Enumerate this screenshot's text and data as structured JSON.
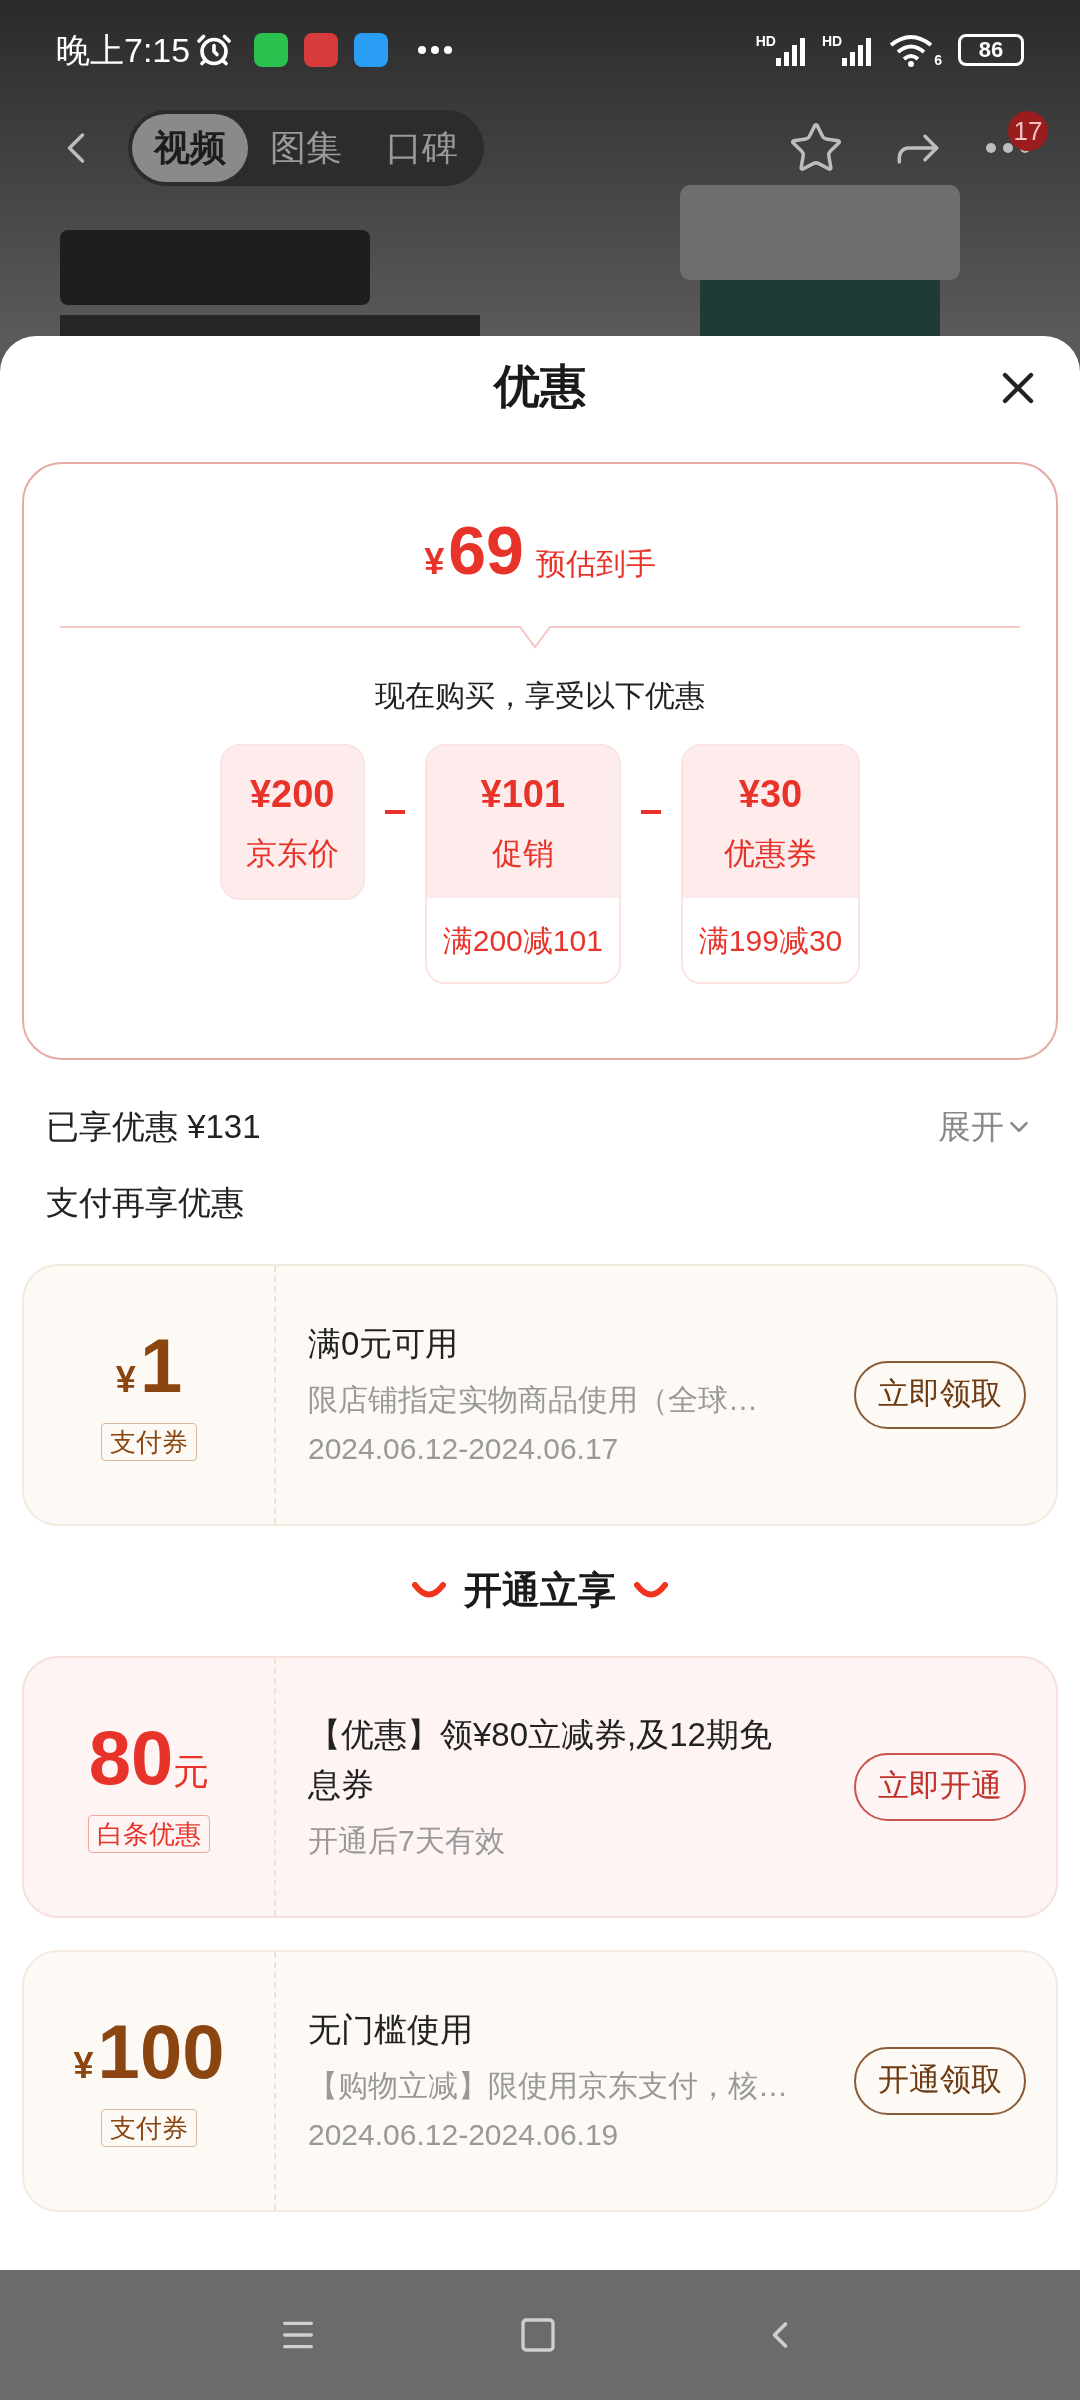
{
  "status_bar": {
    "time": "晚上7:15",
    "signals": [
      {
        "label": "HD"
      },
      {
        "label": "HD"
      }
    ],
    "wifi_label": "6",
    "battery": "86"
  },
  "header": {
    "tabs": [
      {
        "label": "视频",
        "selected": true
      },
      {
        "label": "图集",
        "selected": false
      },
      {
        "label": "口碑",
        "selected": false
      }
    ],
    "badge": "17"
  },
  "sheet": {
    "title": "优惠",
    "estimate": {
      "currency": "¥",
      "price": "69",
      "label": "预估到手"
    },
    "intro": "现在购买，享受以下优惠",
    "breakdown": [
      {
        "amount": "¥200",
        "label": "京东价"
      },
      {
        "amount": "¥101",
        "label": "促销",
        "condition": "满200减101"
      },
      {
        "amount": "¥30",
        "label": "优惠券",
        "condition": "满199减30"
      }
    ],
    "saved": {
      "label": "已享优惠 ¥131",
      "toggle": "展开"
    },
    "pay_heading": "支付再享优惠",
    "pay_coupons": [
      {
        "kind": "pay",
        "currency": "¥",
        "amount": "1",
        "tag": "支付券",
        "title": "满0元可用",
        "desc": "限店铺指定实物商品使用（全球…",
        "date": "2024.06.12-2024.06.17",
        "button": "立即领取"
      }
    ],
    "open_heading": "开通立享",
    "open_coupons": [
      {
        "kind": "baitiao",
        "amount": "80",
        "unit": "元",
        "tag": "白条优惠",
        "title": "【优惠】领¥80立减券,及12期免息券",
        "desc": "开通后7天有效",
        "button": "立即开通"
      },
      {
        "kind": "pay",
        "currency": "¥",
        "amount": "100",
        "tag": "支付券",
        "title": "无门槛使用",
        "desc": "【购物立减】限使用京东支付，核…",
        "date": "2024.06.12-2024.06.19",
        "button": "开通领取"
      }
    ]
  }
}
